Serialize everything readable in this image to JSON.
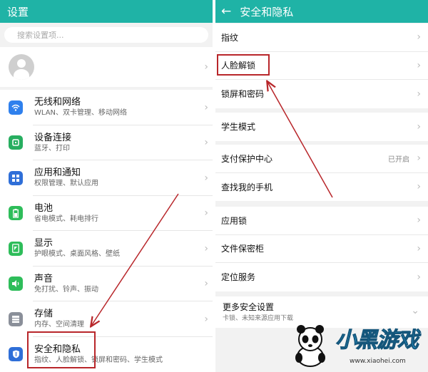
{
  "left": {
    "title": "设置",
    "search_placeholder": "搜索设置项...",
    "items": [
      {
        "title": "无线和网络",
        "subtitle": "WLAN、双卡管理、移动网络",
        "icon": "wifi-icon",
        "color": "#2f80ed"
      },
      {
        "title": "设备连接",
        "subtitle": "蓝牙、打印",
        "icon": "device-connect-icon",
        "color": "#27ae60"
      },
      {
        "title": "应用和通知",
        "subtitle": "权限管理、默认应用",
        "icon": "apps-icon",
        "color": "#2f6fd8"
      },
      {
        "title": "电池",
        "subtitle": "省电模式、耗电排行",
        "icon": "battery-icon",
        "color": "#2ebd5a"
      },
      {
        "title": "显示",
        "subtitle": "护眼模式、桌面风格、壁纸",
        "icon": "display-icon",
        "color": "#2ebd5a"
      },
      {
        "title": "声音",
        "subtitle": "免打扰、铃声、振动",
        "icon": "sound-icon",
        "color": "#2ebd5a"
      },
      {
        "title": "存储",
        "subtitle": "内存、空间清理",
        "icon": "storage-icon",
        "color": "#8a8f99"
      },
      {
        "title": "安全和隐私",
        "subtitle": "指纹、人脸解锁、锁屏和密码、学生模式",
        "icon": "shield-icon",
        "color": "#2f6fd8"
      }
    ]
  },
  "right": {
    "title": "安全和隐私",
    "group1": [
      "指纹",
      "人脸解锁",
      "锁屏和密码"
    ],
    "group2": [
      "学生模式"
    ],
    "group3": [
      {
        "label": "支付保护中心",
        "value": "已开启"
      },
      {
        "label": "查找我的手机",
        "value": ""
      }
    ],
    "group4": [
      "应用锁",
      "文件保密柜",
      "定位服务"
    ],
    "more": {
      "title": "更多安全设置",
      "subtitle": "卡锁、未知来源应用下载"
    }
  },
  "watermark": {
    "logo": "小黑游戏",
    "url": "www.xiaohei.com"
  },
  "colors": {
    "header": "#1fb3a6",
    "highlight": "#b8262a",
    "arrow": "#b8262a"
  }
}
